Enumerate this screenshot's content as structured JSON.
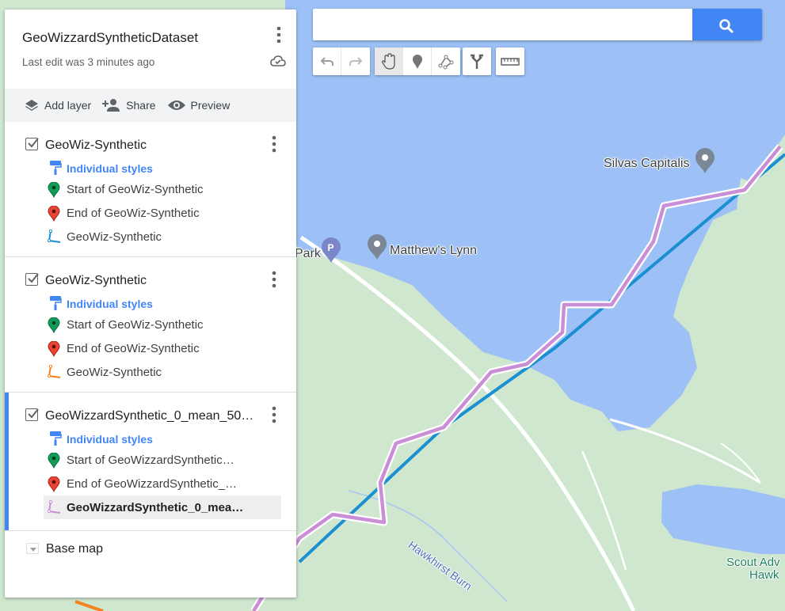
{
  "map": {
    "title": "GeoWizzardSyntheticDataset",
    "last_edit": "Last edit was 3 minutes ago"
  },
  "actions": {
    "add_layer": "Add layer",
    "share": "Share",
    "preview": "Preview"
  },
  "layers": [
    {
      "name": "GeoWiz-Synthetic",
      "styles_label": "Individual styles",
      "items": [
        {
          "label": "Start of GeoWiz-Synthetic",
          "icon": "green-pin-icon"
        },
        {
          "label": "End of GeoWiz-Synthetic",
          "icon": "red-pin-icon"
        },
        {
          "label": "GeoWiz-Synthetic",
          "icon": "line-icon",
          "color": "#1a8fd1"
        }
      ]
    },
    {
      "name": "GeoWiz-Synthetic",
      "styles_label": "Individual styles",
      "items": [
        {
          "label": "Start of GeoWiz-Synthetic",
          "icon": "green-pin-icon"
        },
        {
          "label": "End of GeoWiz-Synthetic",
          "icon": "red-pin-icon"
        },
        {
          "label": "GeoWiz-Synthetic",
          "icon": "line-icon",
          "color": "#f58220"
        }
      ]
    },
    {
      "name": "GeoWizzardSynthetic_0_mean_50…",
      "styles_label": "Individual styles",
      "selected": true,
      "items": [
        {
          "label": "Start of GeoWizzardSynthetic…",
          "icon": "green-pin-icon"
        },
        {
          "label": "End of GeoWizzardSynthetic_…",
          "icon": "red-pin-icon"
        },
        {
          "label": "GeoWizzardSynthetic_0_mea…",
          "icon": "line-icon",
          "color": "#c98ed6",
          "highlighted": true
        }
      ]
    }
  ],
  "base_map": {
    "label": "Base map"
  },
  "search": {
    "placeholder": ""
  },
  "map_labels": {
    "poi1": "Silvas Capitalis",
    "poi2": "Matthew's Lynn",
    "park": "Park",
    "stream": "Hawkhirst Burn",
    "scout1": "Scout Adv",
    "scout2": "Hawk"
  },
  "colors": {
    "water": "#9dc1f6",
    "land": "#cfe6cf",
    "track_blue": "#1a8fd1",
    "track_orange": "#f58220",
    "track_purple": "#c98ed6",
    "accent": "#4285f4"
  }
}
